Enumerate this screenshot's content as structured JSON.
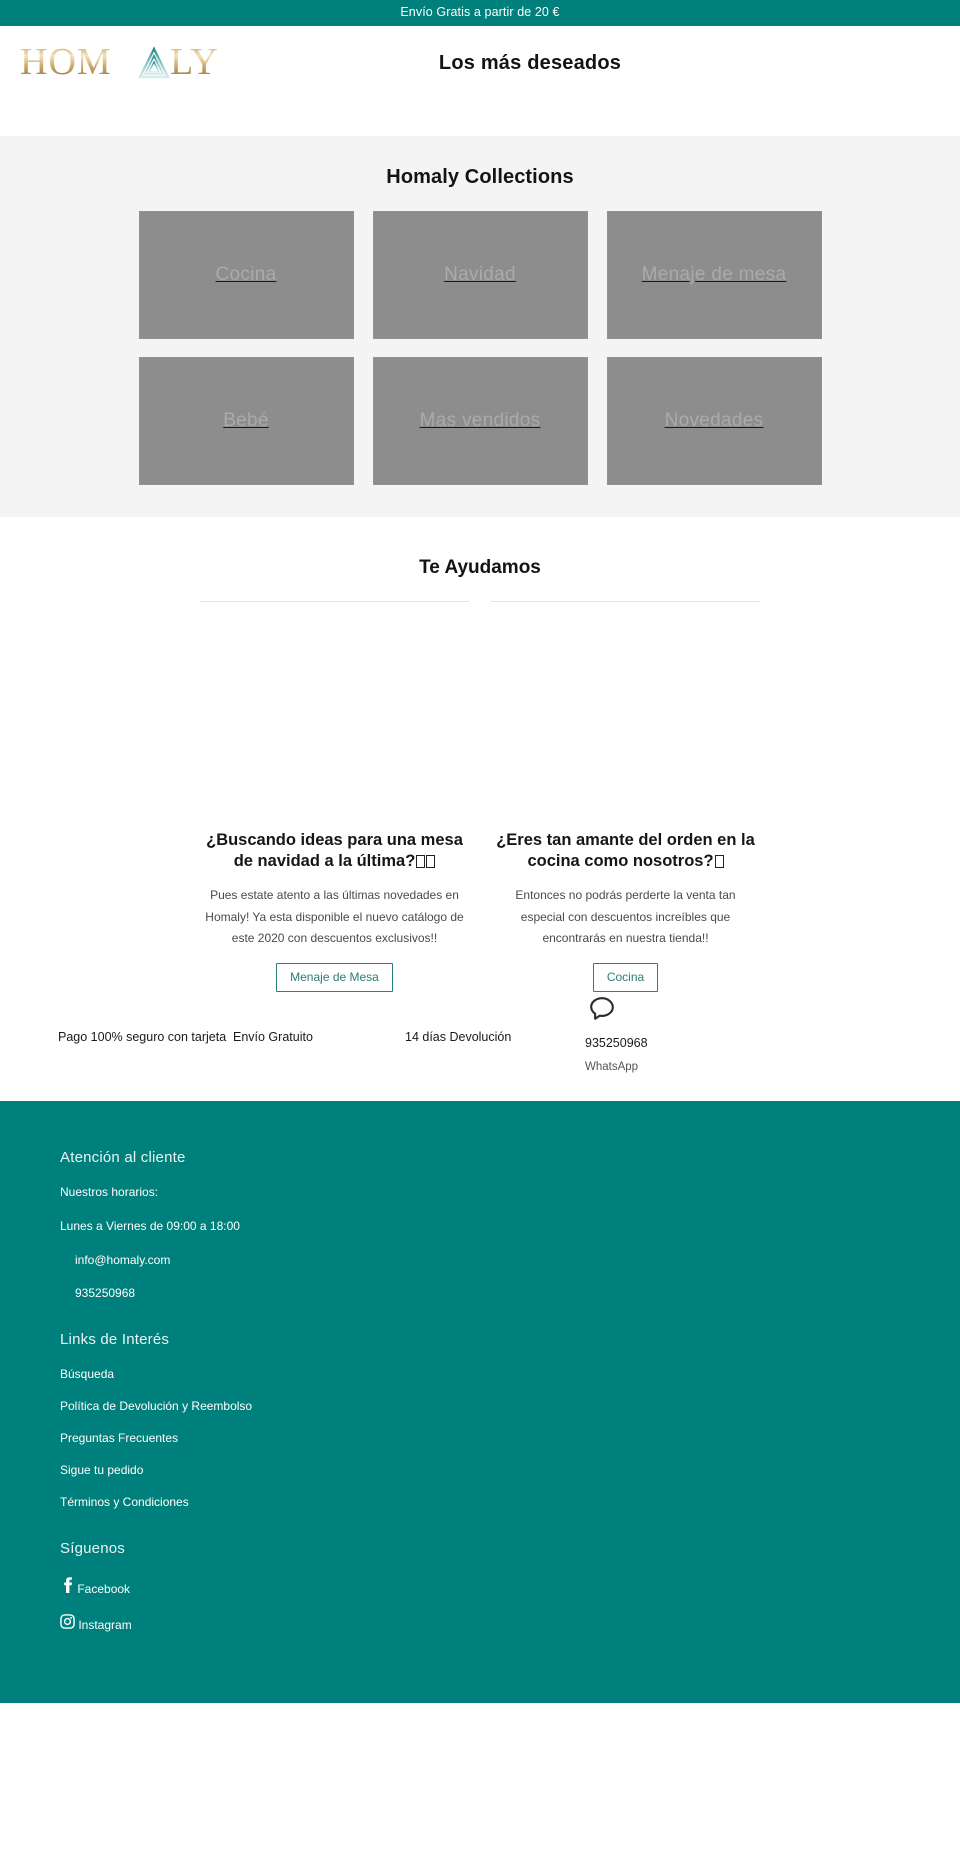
{
  "announcement": {
    "text": "Envío Gratis a partir de 20 €"
  },
  "header": {
    "logo_text": "HOMALY",
    "title": "Los más deseados"
  },
  "collections": {
    "heading": "Homaly Collections",
    "tiles": [
      {
        "label": "Cocina"
      },
      {
        "label": "Navidad"
      },
      {
        "label": "Menaje de mesa"
      },
      {
        "label": "Bebé"
      },
      {
        "label": "Mas vendidos"
      },
      {
        "label": "Novedades"
      }
    ]
  },
  "help": {
    "heading": "Te Ayudamos",
    "cards": [
      {
        "title": "¿Buscando ideas para una mesa de navidad a la última?",
        "body": "Pues estate atento a las últimas novedades en Homaly! Ya esta disponible el nuevo catálogo de este 2020 con descuentos exclusivos!!",
        "button": "Menaje de Mesa"
      },
      {
        "title": "¿Eres tan amante del orden en la cocina como nosotros?",
        "body": "Entonces no podrás perderte la venta tan especial con descuentos increíbles que encontrarás en nuestra tienda!!",
        "button": "Cocina"
      }
    ]
  },
  "trust": {
    "items": [
      {
        "label": "Pago 100% seguro con tarjeta"
      },
      {
        "label": "Envío Gratuito"
      },
      {
        "label": "14 días Devolución"
      }
    ],
    "whatsapp": {
      "number": "935250968",
      "label": "WhatsApp",
      "icon": "chat-bubble-icon"
    }
  },
  "footer": {
    "support": {
      "heading": "Atención al cliente",
      "hours_label": "Nuestros horarios:",
      "hours_value": "Lunes a Viernes de 09:00 a 18:00",
      "email": "info@homaly.com",
      "phone": "935250968"
    },
    "links": {
      "heading": "Links de Interés",
      "items": [
        {
          "label": "Búsqueda"
        },
        {
          "label": "Política de Devolución y Reembolso"
        },
        {
          "label": "Preguntas Frecuentes"
        },
        {
          "label": "Sigue tu pedido"
        },
        {
          "label": "Términos y Condiciones"
        }
      ]
    },
    "social": {
      "heading": "Síguenos",
      "items": [
        {
          "label": "Facebook",
          "icon": "facebook-icon"
        },
        {
          "label": "Instagram",
          "icon": "instagram-icon"
        }
      ]
    }
  },
  "colors": {
    "brand_teal": "#00807c",
    "button_teal": "#2d7d78",
    "tile_gray": "#8d8d8d",
    "section_bg": "#f4f4f4"
  }
}
